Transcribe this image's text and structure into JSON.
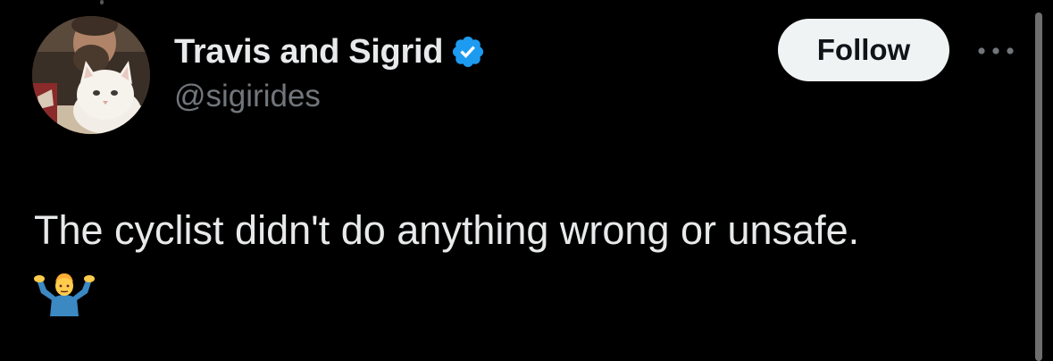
{
  "tweet": {
    "author": {
      "display_name": "Travis and Sigrid",
      "handle": "@sigirides",
      "verified": true,
      "avatar": "man-with-white-cat-avatar"
    },
    "follow_label": "Follow",
    "more_icon": "more-horizontal-icon",
    "text": "The cyclist didn't do anything wrong or unsafe.",
    "emoji": "shrug-emoji"
  },
  "colors": {
    "background": "#000000",
    "primary_text": "#e7e9ea",
    "secondary_text": "#71767b",
    "verified_blue": "#1d9bf0",
    "follow_button_bg": "#eff3f4",
    "follow_button_text": "#0f1419"
  }
}
